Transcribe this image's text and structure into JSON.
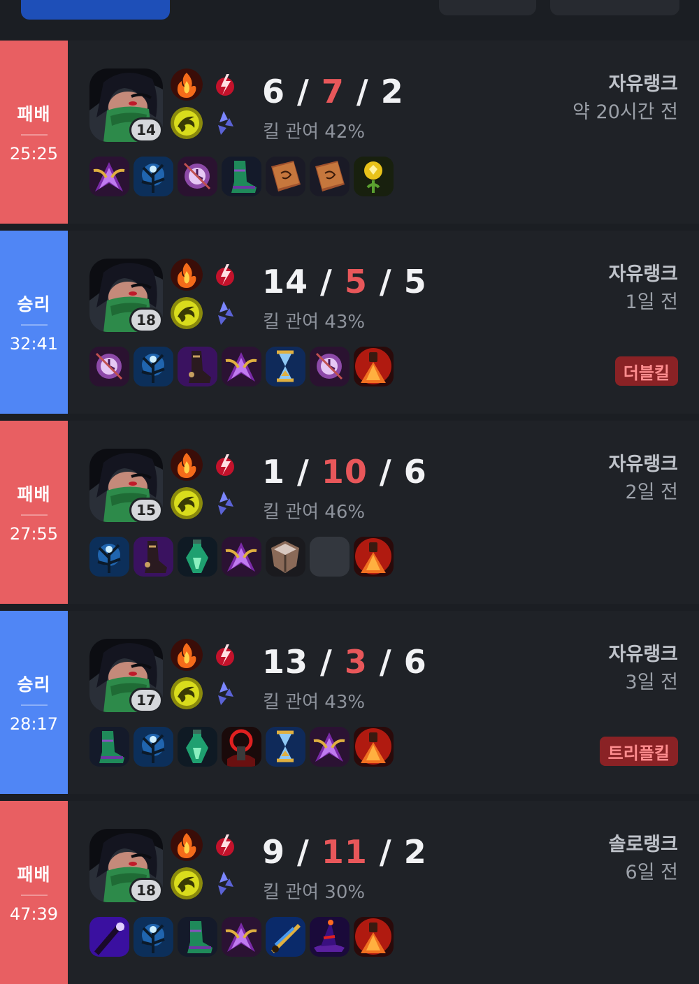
{
  "matches": [
    {
      "result": "패배",
      "outcome": "loss",
      "duration": "25:25",
      "level": "14",
      "kda": {
        "k": "6",
        "d": "7",
        "a": "2"
      },
      "kill_participation": "킬 관여 42%",
      "queue": "자유랭크",
      "time_ago": "약 20시간 전",
      "badge": "",
      "items": [
        "purple-wing-item-icon",
        "blue-tree-staff-icon",
        "purple-clock-orb-icon",
        "green-boots-icon",
        "tome-book-icon",
        "tome-book-icon",
        "golden-ward-trinket-icon"
      ]
    },
    {
      "result": "승리",
      "outcome": "win",
      "duration": "32:41",
      "level": "18",
      "kda": {
        "k": "14",
        "d": "5",
        "a": "5"
      },
      "kill_participation": "킬 관여 43%",
      "queue": "자유랭크",
      "time_ago": "1일 전",
      "badge": "더블킬",
      "items": [
        "purple-clock-orb-icon",
        "blue-tree-staff-icon",
        "purple-boots-icon",
        "purple-wing-item-icon",
        "golden-hourglass-icon",
        "purple-clock-orb-icon",
        "red-lens-trinket-icon"
      ]
    },
    {
      "result": "패배",
      "outcome": "loss",
      "duration": "27:55",
      "level": "15",
      "kda": {
        "k": "1",
        "d": "10",
        "a": "6"
      },
      "kill_participation": "킬 관여 46%",
      "queue": "자유랭크",
      "time_ago": "2일 전",
      "badge": "",
      "items": [
        "blue-tree-staff-icon",
        "purple-boots-icon",
        "green-potion-icon",
        "purple-wing-item-icon",
        "stone-shield-icon",
        "empty-slot",
        "red-lens-trinket-icon"
      ]
    },
    {
      "result": "승리",
      "outcome": "win",
      "duration": "28:17",
      "level": "17",
      "kda": {
        "k": "13",
        "d": "3",
        "a": "6"
      },
      "kill_participation": "킬 관여 43%",
      "queue": "자유랭크",
      "time_ago": "3일 전",
      "badge": "트리플킬",
      "items": [
        "green-boots-icon",
        "blue-tree-staff-icon",
        "green-potion-icon",
        "red-halo-item-icon",
        "golden-hourglass-icon",
        "purple-wing-item-icon",
        "red-lens-trinket-icon"
      ]
    },
    {
      "result": "패배",
      "outcome": "loss",
      "duration": "47:39",
      "level": "18",
      "kda": {
        "k": "9",
        "d": "11",
        "a": "2"
      },
      "kill_participation": "킬 관여 30%",
      "queue": "솔로랭크",
      "time_ago": "6일 전",
      "badge": "",
      "items": [
        "purple-staff-icon",
        "blue-tree-staff-icon",
        "green-boots-icon",
        "purple-wing-item-icon",
        "blue-gold-blade-icon",
        "purple-hat-icon",
        "red-lens-trinket-icon"
      ]
    }
  ],
  "colors": {
    "loss": "#e85f62",
    "win": "#5086f5",
    "death": "#e8575a",
    "background": "#1b1e23"
  }
}
